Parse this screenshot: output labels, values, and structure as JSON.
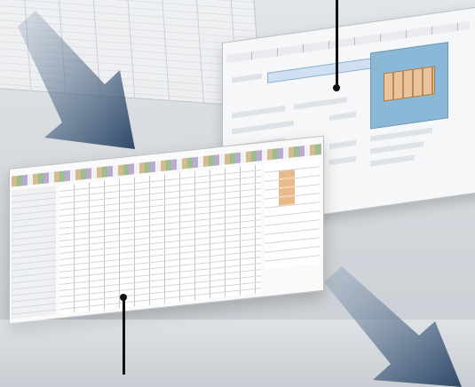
{
  "colors": {
    "background": "#d7dbe0",
    "arrow_dark": "#2e4868",
    "arrow_light": "#7b93ad",
    "leader_line": "#111111",
    "preview_panel": "#8bb8d6",
    "highlight_cells": "#e7b98b"
  },
  "icons": {
    "arrow_top_left": "diagonal-down-right-arrow",
    "arrow_bottom_right": "diagonal-down-right-arrow"
  }
}
